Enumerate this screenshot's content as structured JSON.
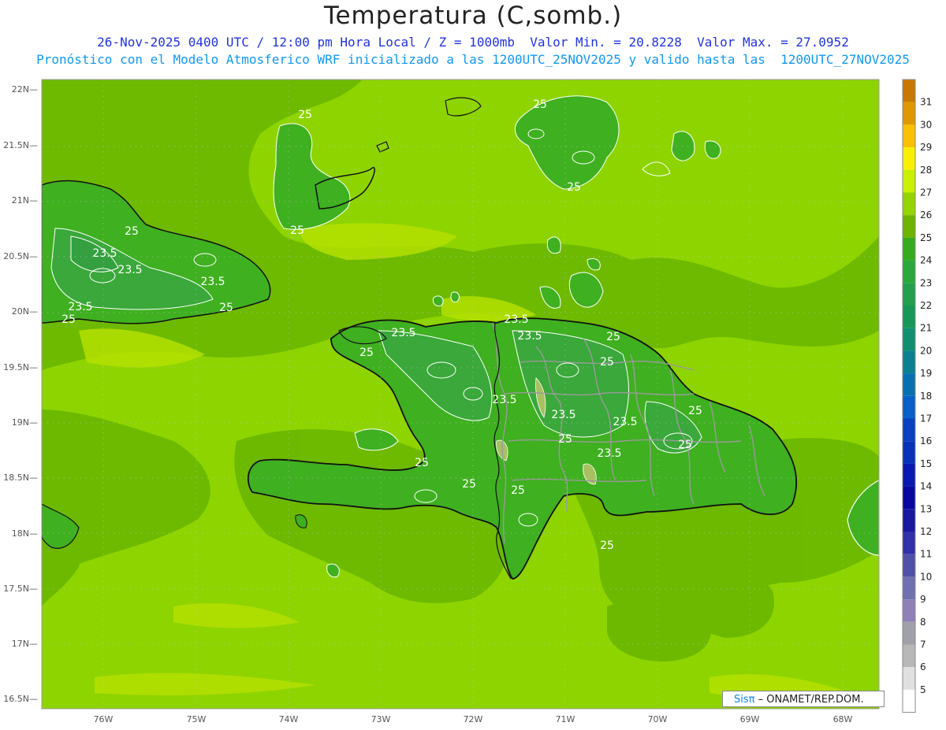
{
  "header": {
    "title": "Temperatura (C,somb.)",
    "line1": "26-Nov-2025 0400 UTC / 12:00 pm Hora Local / Z = 1000mb  Valor Min. = 20.8228  Valor Max. = 27.0952",
    "line2": "Pronóstico con el Modelo Atmosferico WRF inicializado a las 1200UTC_25NOV2025 y valido hasta las  1200UTC_27NOV2025"
  },
  "map": {
    "lat_labels": [
      "22N",
      "21.5N",
      "21N",
      "20.5N",
      "20N",
      "19.5N",
      "19N",
      "18.5N",
      "18N",
      "17.5N",
      "17N",
      "16.5N"
    ],
    "lon_labels": [
      "76W",
      "75W",
      "74W",
      "73W",
      "72W",
      "71W",
      "70W",
      "69W",
      "68W"
    ],
    "contour_labels": [
      "25",
      "25",
      "25",
      "25",
      "23.5",
      "23.5",
      "23.5",
      "23.5",
      "25",
      "25",
      "25",
      "23.5",
      "23.5",
      "25",
      "23.5",
      "23.5",
      "23.5",
      "23.5",
      "25",
      "23.5",
      "25",
      "25",
      "25",
      "25",
      "25",
      "25",
      "25",
      "25"
    ],
    "colors": {
      "sea": "#8ed400",
      "shade_25": "#6bb800",
      "land_24": "#3fb020",
      "land_23": "#3aa83a",
      "warm_26": "#b4e000",
      "coast": "#111111",
      "border": "#aaaaaa",
      "contour": "#ffffff"
    }
  },
  "colorbar": {
    "labels": [
      "31",
      "30",
      "29",
      "28",
      "27",
      "26",
      "25",
      "24",
      "23",
      "22",
      "21",
      "20",
      "19",
      "18",
      "17",
      "16",
      "15",
      "14",
      "13",
      "12",
      "11",
      "10",
      "9",
      "8",
      "7",
      "6",
      "5"
    ],
    "colors": [
      "#c87800",
      "#e09800",
      "#f8c000",
      "#f8f000",
      "#c8f000",
      "#96d400",
      "#6cb400",
      "#34ac1e",
      "#2aa83c",
      "#22a04c",
      "#189858",
      "#109070",
      "#0a8090",
      "#0870b0",
      "#0860c8",
      "#0840c0",
      "#0830b8",
      "#0818b0",
      "#0808a0",
      "#1818a0",
      "#3030a8",
      "#5050a8",
      "#7070b0",
      "#9080b8",
      "#a0a0a8",
      "#b8b8b8",
      "#e0e0e0",
      "#ffffff"
    ]
  },
  "credit": {
    "brand": "Sisπ",
    "text": "– ONAMET/REP.DOM."
  }
}
